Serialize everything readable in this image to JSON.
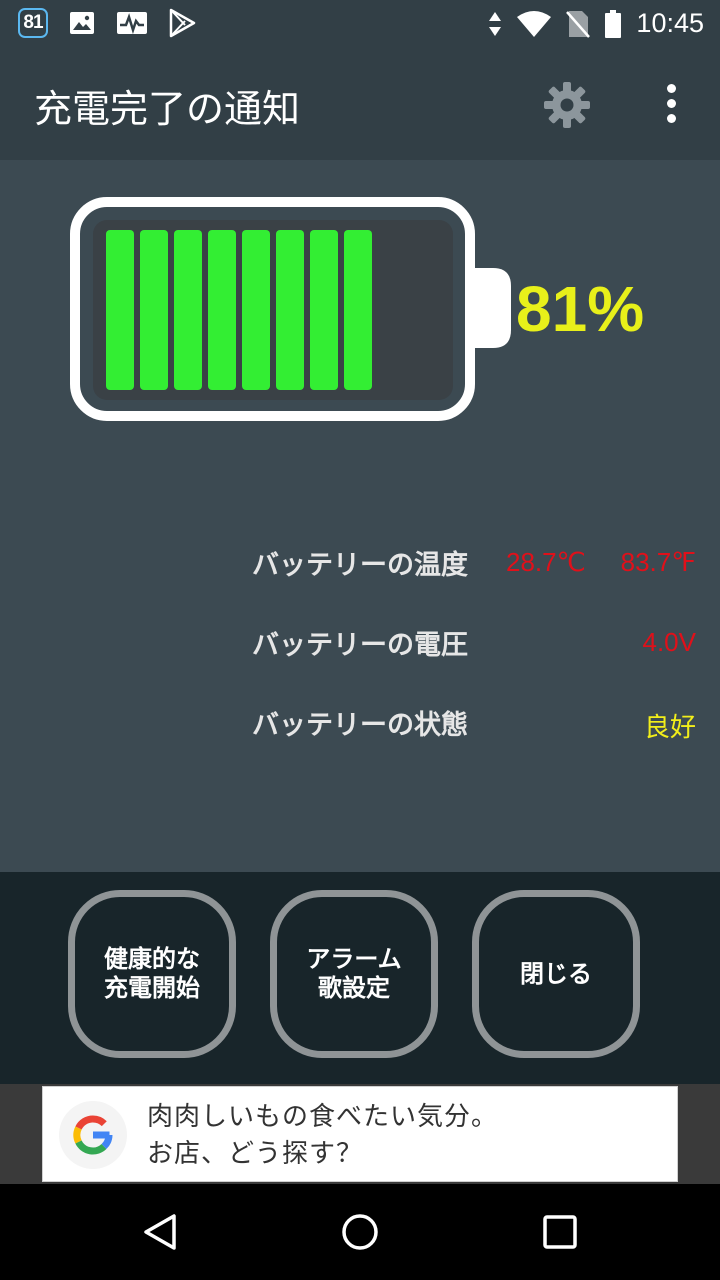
{
  "status_bar": {
    "badge": "81",
    "time": "10:45",
    "left_icons": [
      "image-icon",
      "pulse-icon",
      "play-store-icon"
    ],
    "right_icons": [
      "data-arrows-icon",
      "wifi-icon",
      "no-sim-icon",
      "battery-icon"
    ]
  },
  "app_bar": {
    "title": "充電完了の通知",
    "settings_icon": "gear-icon",
    "menu_icon": "more-vert-icon"
  },
  "battery": {
    "percent_label": "81%",
    "level": 0.81,
    "filled_cells": 8,
    "total_cells": 10,
    "cell_color": "#33ee33",
    "percent_color": "#e8f01a"
  },
  "info": {
    "temperature_label": "バッテリーの温度",
    "temperature_c": "28.7℃",
    "temperature_f": "83.7℉",
    "voltage_label": "バッテリーの電圧",
    "voltage_value": "4.0V",
    "health_label": "バッテリーの状態",
    "health_value": "良好"
  },
  "buttons": {
    "healthy_charge": "健康的な\n充電開始",
    "alarm_song": "アラーム\n歌設定",
    "close": "閉じる"
  },
  "ad": {
    "text": "肉肉しいもの食べたい気分。\nお店、どう探す？",
    "logo": "google-g-icon"
  },
  "nav_bar": {
    "back": "back-icon",
    "home": "home-icon",
    "recents": "recents-icon"
  }
}
